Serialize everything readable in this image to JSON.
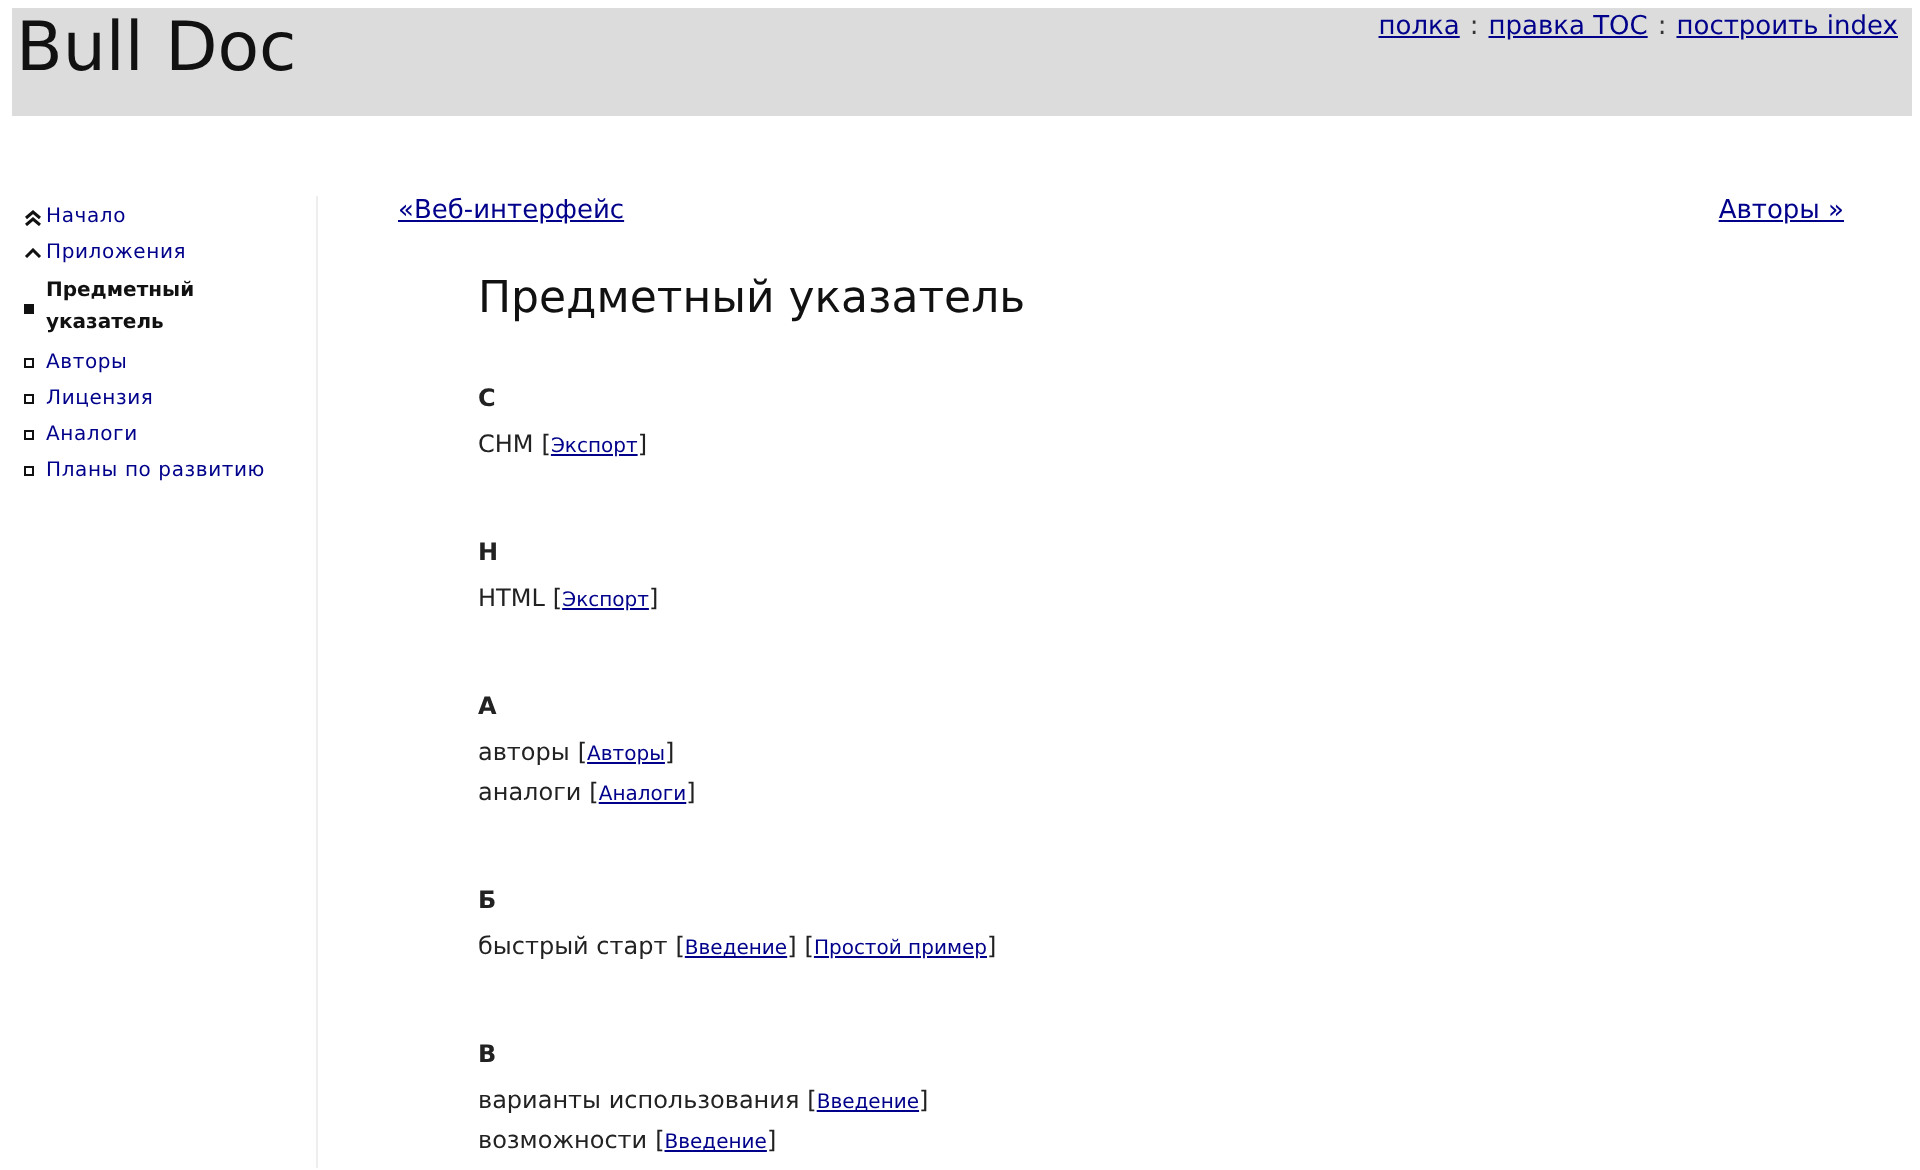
{
  "header": {
    "title": "Bull Doc",
    "links": [
      "полка",
      "правка TOC",
      "построить index"
    ],
    "separator": ":"
  },
  "sidebar": {
    "items": [
      {
        "label": "Начало",
        "kind": "top",
        "selected": false
      },
      {
        "label": "Приложения",
        "kind": "up",
        "selected": false
      },
      {
        "label": "Предметный указатель",
        "kind": "page",
        "selected": true
      },
      {
        "label": "Авторы",
        "kind": "page",
        "selected": false
      },
      {
        "label": "Лицензия",
        "kind": "page",
        "selected": false
      },
      {
        "label": "Аналоги",
        "kind": "page",
        "selected": false
      },
      {
        "label": "Планы по развитию",
        "kind": "page",
        "selected": false
      }
    ]
  },
  "pager": {
    "previous": "«Веб-интерфейс",
    "next": "Авторы »"
  },
  "page_title": "Предметный указатель",
  "index": {
    "bracket_open": "[",
    "bracket_close": "]",
    "sections": [
      {
        "letter": "C",
        "entries": [
          {
            "term": "CHM",
            "refs": [
              "Экспорт"
            ]
          }
        ]
      },
      {
        "letter": "H",
        "entries": [
          {
            "term": "HTML",
            "refs": [
              "Экспорт"
            ]
          }
        ]
      },
      {
        "letter": "А",
        "entries": [
          {
            "term": "авторы",
            "refs": [
              "Авторы"
            ]
          },
          {
            "term": "аналоги",
            "refs": [
              "Аналоги"
            ]
          }
        ]
      },
      {
        "letter": "Б",
        "entries": [
          {
            "term": "быстрый старт",
            "refs": [
              "Введение",
              "Простой пример"
            ]
          }
        ]
      },
      {
        "letter": "В",
        "entries": [
          {
            "term": "варианты использования",
            "refs": [
              "Введение"
            ]
          },
          {
            "term": "возможности",
            "refs": [
              "Введение"
            ]
          }
        ]
      }
    ]
  }
}
